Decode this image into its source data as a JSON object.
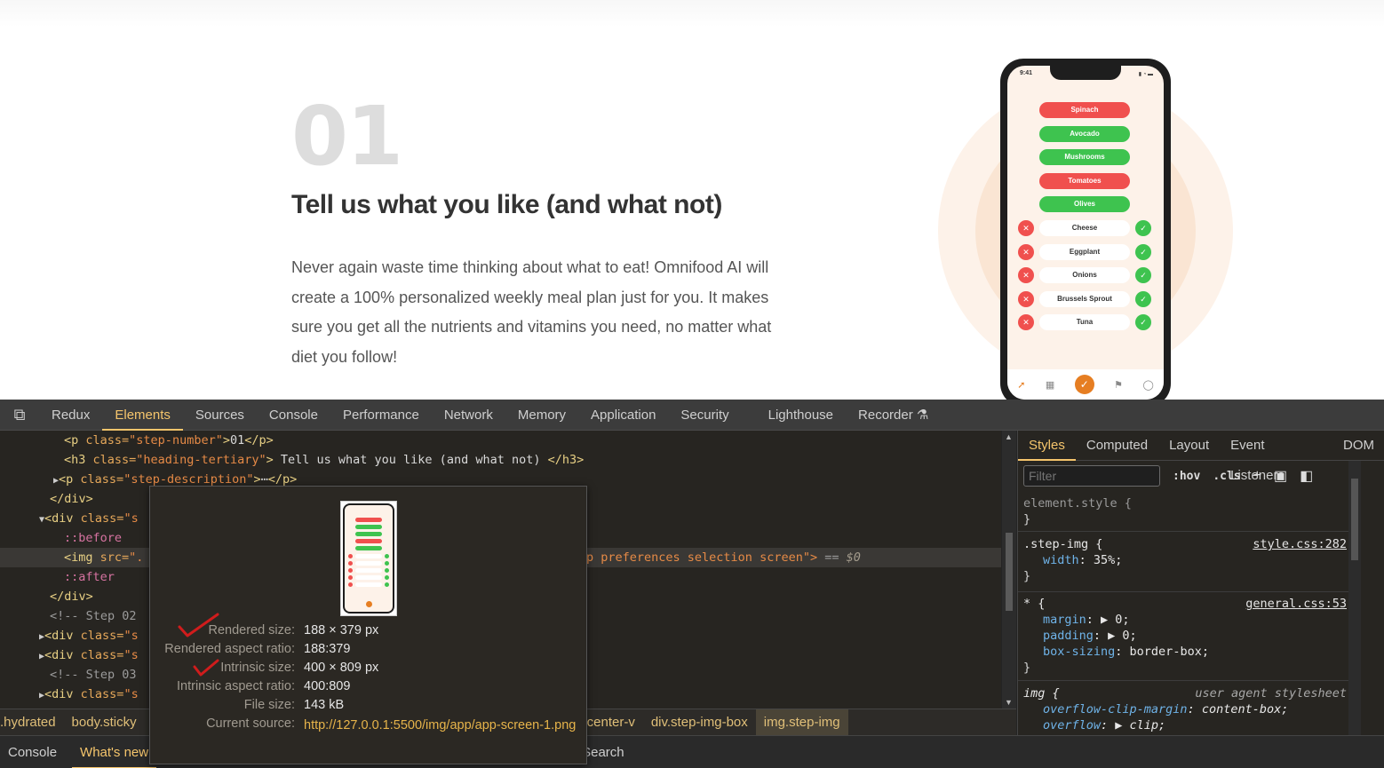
{
  "site": {
    "step_number": "01",
    "heading": "Tell us what you like (and what not)",
    "description": "Never again waste time thinking about what to eat! Omnifood AI will create a 100% personalized weekly meal plan just for you. It makes sure you get all the nutrients and vitamins you need, no matter what diet you follow!",
    "phone": {
      "time": "9:41",
      "status": "▮ ◔ ▬",
      "pills": [
        {
          "label": "Spinach",
          "color": "red"
        },
        {
          "label": "Avocado",
          "color": "green"
        },
        {
          "label": "Mushrooms",
          "color": "green"
        },
        {
          "label": "Tomatoes",
          "color": "red"
        },
        {
          "label": "Olives",
          "color": "green"
        }
      ],
      "choices": [
        "Cheese",
        "Eggplant",
        "Onions",
        "Brussels Sprout",
        "Tuna"
      ]
    }
  },
  "devtools": {
    "tabs": [
      "Redux",
      "Elements",
      "Sources",
      "Console",
      "Performance",
      "Network",
      "Memory",
      "Application",
      "Security",
      "Lighthouse",
      "Recorder"
    ],
    "active_tab": "Elements",
    "dom": {
      "l1_tag_open": "<p ",
      "l1_attr": "class=",
      "l1_val": "\"step-number\"",
      "l1_text": "01",
      "l1_close": "</p>",
      "l2_tag_open": "<h3 ",
      "l2_attr": "class=",
      "l2_val": "\"heading-tertiary\"",
      "l2_text": " Tell us what you like (and what not) ",
      "l2_close": "</h3>",
      "l3_tag_open": "<p ",
      "l3_attr": "class=",
      "l3_val": "\"step-description\"",
      "l3_ellipsis": "⋯",
      "l3_close": "</p>",
      "l4": "</div>",
      "l5_tag": "<div ",
      "l5_attr": "class=",
      "l5_val": "\"s",
      "l6": "::before",
      "l7_tag": "<img ",
      "l7_attr": "src=",
      "l7_val": "\".",
      "l7_tail": "p preferences selection screen\">",
      "l7_eq": " == ",
      "l7_dollar": "$0",
      "l8": "::after",
      "l9": "</div>",
      "l10": "<!-- Step 02",
      "l11_tag": "<div ",
      "l11_attr": "class=",
      "l11_val": "\"s",
      "l12_tag": "<div ",
      "l12_attr": "class=",
      "l12_val": "\"s",
      "l13": "<!-- Step 03",
      "l14_tag": "<div ",
      "l14_attr": "class=",
      "l14_val": "\"s"
    },
    "breadcrumbs": [
      ".hydrated",
      "body.sticky",
      "-center-v",
      "div.step-img-box",
      "img.step-img"
    ],
    "drawer_tabs": [
      "Console",
      "What's new",
      "Search"
    ],
    "styles_tabs": [
      "Styles",
      "Computed",
      "Layout",
      "Event Listeners",
      "DOM"
    ],
    "filter_placeholder": "Filter",
    "hov": ":hov",
    "cls": ".cls",
    "rules": {
      "element_style": "element.style {",
      "brace_close": "}",
      "step_img_selector": ".step-img {",
      "step_img_src": "style.css:282",
      "width_prop": "width",
      "width_val": "35%;",
      "star_selector": "* {",
      "star_src": "general.css:53",
      "margin_prop": "margin",
      "margin_val": "0;",
      "padding_prop": "padding",
      "padding_val": "0;",
      "boxsizing_prop": "box-sizing",
      "boxsizing_val": "border-box;",
      "img_selector": "img {",
      "img_src": "user agent stylesheet",
      "ocm_prop": "overflow-clip-margin",
      "ocm_val": "content-box;",
      "overflow_prop": "overflow",
      "overflow_val": "clip;"
    },
    "tooltip": {
      "rendered_size_label": "Rendered size:",
      "rendered_size": "188 × 379 px",
      "rendered_ratio_label": "Rendered aspect ratio:",
      "rendered_ratio": "188:379",
      "intrinsic_size_label": "Intrinsic size:",
      "intrinsic_size": "400 × 809 px",
      "intrinsic_ratio_label": "Intrinsic aspect ratio:",
      "intrinsic_ratio": "400:809",
      "file_size_label": "File size:",
      "file_size": "143 kB",
      "source_label": "Current source:",
      "source": "http://127.0.0.1:5500/img/app/app-screen-1.png"
    }
  }
}
